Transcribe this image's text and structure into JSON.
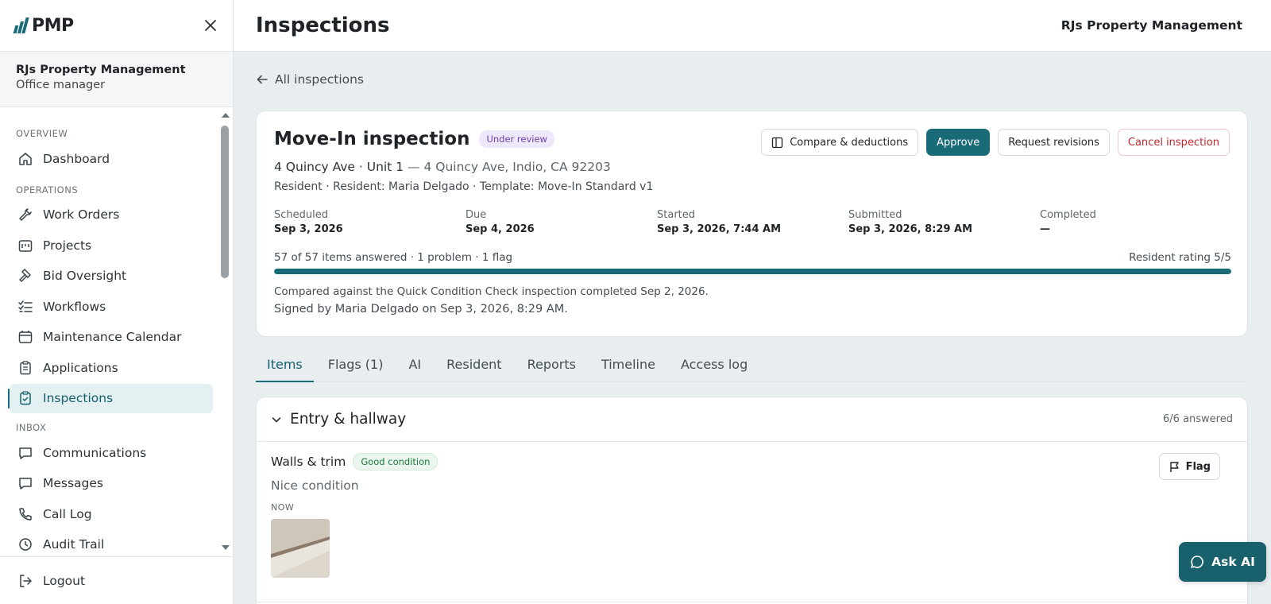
{
  "brand": {
    "logo_text": "PMP",
    "accent": "#1a6b78"
  },
  "org": {
    "name": "RJs Property Management",
    "role": "Office manager"
  },
  "sidebar": {
    "sections": {
      "overview": "OVERVIEW",
      "operations": "OPERATIONS",
      "inbox": "INBOX"
    },
    "items": [
      {
        "label": "Dashboard",
        "icon": "home-icon"
      },
      {
        "label": "Work Orders",
        "icon": "wrench-icon"
      },
      {
        "label": "Projects",
        "icon": "projects-icon"
      },
      {
        "label": "Bid Oversight",
        "icon": "gavel-icon"
      },
      {
        "label": "Workflows",
        "icon": "checklist-icon"
      },
      {
        "label": "Maintenance Calendar",
        "icon": "calendar-icon"
      },
      {
        "label": "Applications",
        "icon": "clipboard-icon"
      },
      {
        "label": "Inspections",
        "icon": "clipboard-check-icon",
        "active": true
      },
      {
        "label": "Communications",
        "icon": "message-icon"
      },
      {
        "label": "Messages",
        "icon": "message-icon"
      },
      {
        "label": "Call Log",
        "icon": "phone-icon"
      },
      {
        "label": "Audit Trail",
        "icon": "history-icon"
      }
    ],
    "logout": "Logout"
  },
  "header": {
    "title": "Inspections",
    "org": "RJs Property Management"
  },
  "back_link": "All inspections",
  "inspection": {
    "title": "Move-In inspection",
    "status": "Under review",
    "address_main": "4 Quincy Ave · Unit 1",
    "address_full": "— 4 Quincy Ave, Indio, CA 92203",
    "meta": "Resident · Resident: Maria Delgado · Template: Move-In Standard v1",
    "actions": {
      "compare": "Compare & deductions",
      "approve": "Approve",
      "revisions": "Request revisions",
      "cancel": "Cancel inspection"
    },
    "dates": [
      {
        "label": "Scheduled",
        "value": "Sep 3, 2026"
      },
      {
        "label": "Due",
        "value": "Sep 4, 2026"
      },
      {
        "label": "Started",
        "value": "Sep 3, 2026, 7:44 AM"
      },
      {
        "label": "Submitted",
        "value": "Sep 3, 2026, 8:29 AM"
      },
      {
        "label": "Completed",
        "value": "—"
      }
    ],
    "progress_text": "57 of 57 items answered · 1 problem · 1 flag",
    "progress_fraction": 1.0,
    "rating": "Resident rating 5/5",
    "compare_note": "Compared against the Quick Condition Check inspection completed Sep 2, 2026.",
    "signed_note": "Signed by Maria Delgado on Sep 3, 2026, 8:29 AM."
  },
  "tabs": [
    "Items",
    "Flags (1)",
    "AI",
    "Resident",
    "Reports",
    "Timeline",
    "Access log"
  ],
  "section": {
    "title": "Entry & hallway",
    "count": "6/6 answered",
    "item": {
      "title": "Walls & trim",
      "condition": "Good condition",
      "note": "Nice condition",
      "photo_label": "NOW",
      "flag_label": "Flag"
    }
  },
  "ask_ai": "Ask AI"
}
